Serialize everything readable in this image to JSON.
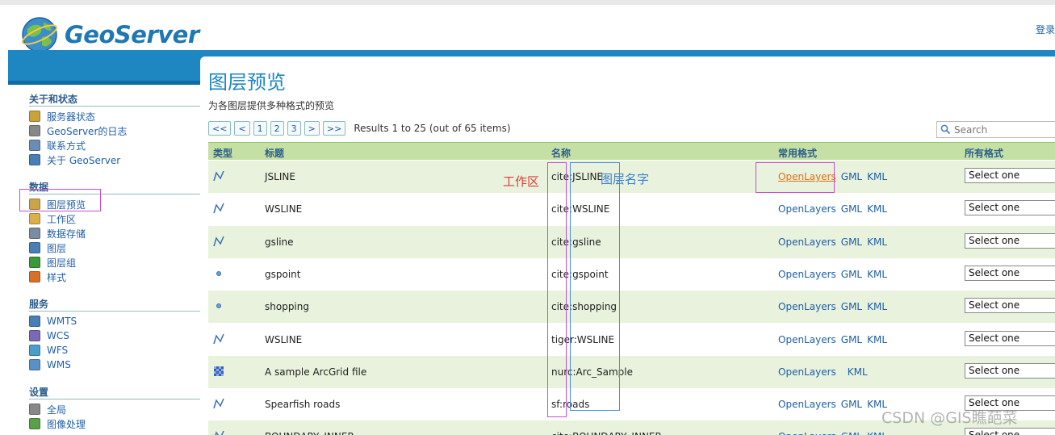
{
  "header": {
    "logo_text": "GeoServer",
    "login_text": "登录",
    "colors": {
      "brand": "#1e86c1",
      "link": "#1f5fa8"
    }
  },
  "sidebar": {
    "sections": [
      {
        "title": "关于和状态",
        "items": [
          {
            "label": "服务器状态",
            "icon": "server-status-icon"
          },
          {
            "label": "GeoServer的日志",
            "icon": "log-icon"
          },
          {
            "label": "联系方式",
            "icon": "contact-icon"
          },
          {
            "label": "关于 GeoServer",
            "icon": "info-icon"
          }
        ]
      },
      {
        "title": "数据",
        "items": [
          {
            "label": "图层预览",
            "icon": "layer-preview-icon"
          },
          {
            "label": "工作区",
            "icon": "folder-icon"
          },
          {
            "label": "数据存储",
            "icon": "datastore-icon"
          },
          {
            "label": "图层",
            "icon": "layer-icon"
          },
          {
            "label": "图层组",
            "icon": "layer-group-icon"
          },
          {
            "label": "样式",
            "icon": "style-icon"
          }
        ]
      },
      {
        "title": "服务",
        "items": [
          {
            "label": "WMTS",
            "icon": "wmts-icon"
          },
          {
            "label": "WCS",
            "icon": "wcs-icon"
          },
          {
            "label": "WFS",
            "icon": "wfs-icon"
          },
          {
            "label": "WMS",
            "icon": "wms-icon"
          }
        ]
      },
      {
        "title": "设置",
        "items": [
          {
            "label": "全局",
            "icon": "global-icon"
          },
          {
            "label": "图像处理",
            "icon": "image-processing-icon"
          }
        ]
      }
    ]
  },
  "main": {
    "title": "图层预览",
    "subtitle": "为各图层提供多种格式的预览",
    "pager": {
      "first": "<<",
      "prev": "<",
      "pages": [
        "1",
        "2",
        "3"
      ],
      "next": ">",
      "last": ">>",
      "info": "Results 1 to 25 (out of 65 items)"
    },
    "search_placeholder": "Search",
    "columns": {
      "type": "类型",
      "title": "标题",
      "name": "名称",
      "common": "常用格式",
      "all": "所有格式"
    },
    "formats": [
      "OpenLayers",
      "GML",
      "KML"
    ],
    "select_label": "Select one",
    "rows": [
      {
        "type": "line",
        "title": "JSLINE",
        "name": "cite:JSLINE",
        "gml": true
      },
      {
        "type": "line",
        "title": "WSLINE",
        "name": "cite:WSLINE",
        "gml": true
      },
      {
        "type": "line",
        "title": "gsline",
        "name": "cite:gsline",
        "gml": true
      },
      {
        "type": "point",
        "title": "gspoint",
        "name": "cite:gspoint",
        "gml": true
      },
      {
        "type": "point",
        "title": "shopping",
        "name": "cite:shopping",
        "gml": true
      },
      {
        "type": "line",
        "title": "WSLINE",
        "name": "tiger:WSLINE",
        "gml": true
      },
      {
        "type": "raster",
        "title": "A sample ArcGrid file",
        "name": "nurc:Arc_Sample",
        "gml": false
      },
      {
        "type": "line",
        "title": "Spearfish roads",
        "name": "sf:roads",
        "gml": true
      },
      {
        "type": "line",
        "title": "BOUNDARY_INNER",
        "name": "cite:BOUNDARY_INNER",
        "gml": true
      }
    ]
  },
  "annotations": {
    "workspace_label": "工作区",
    "layername_label": "图层名字"
  },
  "watermark": "CSDN @GIS瞧葩菜"
}
